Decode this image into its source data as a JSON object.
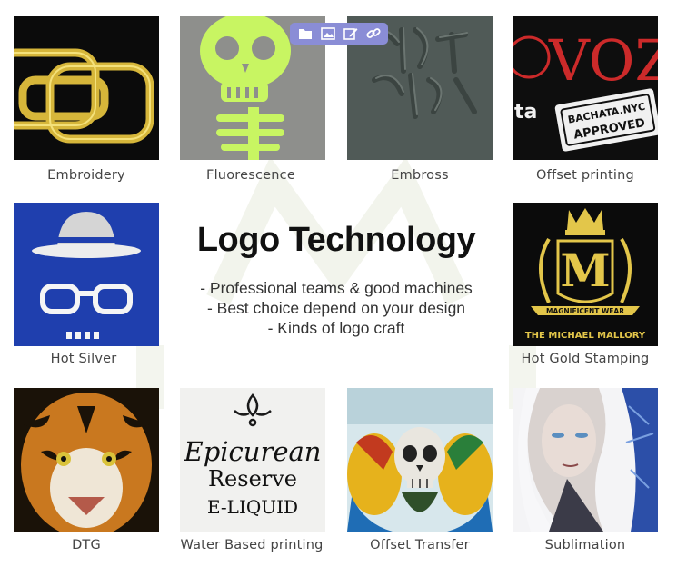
{
  "toolbar": {
    "buttons": [
      {
        "icon": "folder-icon"
      },
      {
        "icon": "image-icon"
      },
      {
        "icon": "edit-icon"
      },
      {
        "icon": "link-icon"
      }
    ]
  },
  "center": {
    "title": "Logo Technology",
    "bullets": [
      "- Professional teams & good machines",
      "- Best choice depend on your design",
      "- Kinds of logo craft"
    ]
  },
  "tiles": [
    {
      "caption": "Embroidery"
    },
    {
      "caption": "Fluorescence"
    },
    {
      "caption": "Embross"
    },
    {
      "caption": "Offset printing",
      "art_text": [
        "VOZ",
        "BACHATA.NYC",
        "APPROVED",
        "ta"
      ]
    },
    {
      "caption": "Hot Silver"
    },
    {
      "caption": "Hot Gold Stamping",
      "art_text": [
        "MAGNIFICENT WEAR",
        "THE MICHAEL MALLORY"
      ]
    },
    {
      "caption": "DTG"
    },
    {
      "caption": "Water Based printing",
      "art_text": [
        "Epicurean",
        "Reserve",
        "E-LIQUID"
      ]
    },
    {
      "caption": "Offset Transfer"
    },
    {
      "caption": "Sublimation"
    }
  ],
  "colors": {
    "toolbar": "#8a8dd6",
    "caption": "#444444",
    "neon": "#c8f562",
    "gold": "#d9b93a"
  }
}
